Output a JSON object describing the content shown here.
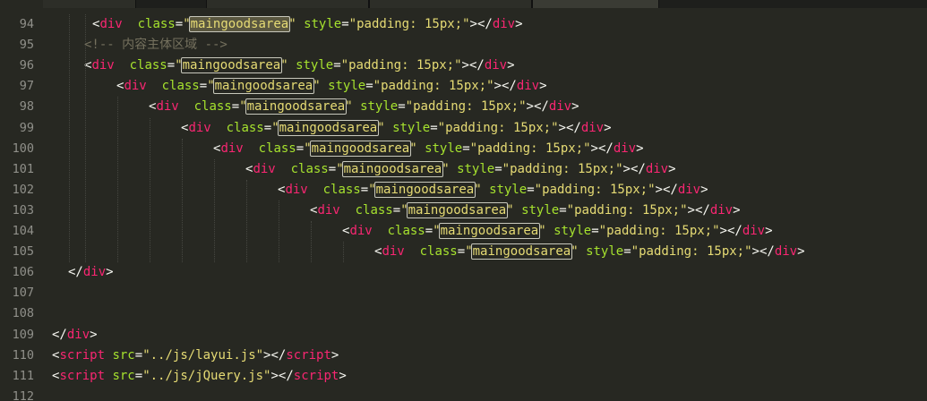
{
  "editor": {
    "tabs": [
      {
        "label": "",
        "active": false
      },
      {
        "label": "",
        "active": false
      },
      {
        "label": "",
        "active": false
      },
      {
        "label": "",
        "active": true
      }
    ]
  },
  "lines": [
    {
      "num": "94",
      "indent": 5,
      "kind": "div",
      "tag_open": "<",
      "tag": "div",
      "sp1": "  ",
      "attr": "class",
      "eq": "=",
      "q1": "\"",
      "cls": "maingoodsarea",
      "q2": "\"",
      "sp2": " ",
      "style_attr": "style",
      "eq2": "=",
      "style_val": "\"padding: 15px;\"",
      "close": "></",
      "close_tag": "div",
      "end": ">",
      "selected": true
    },
    {
      "num": "95",
      "indent": 4,
      "kind": "comment",
      "text": "<!-- 内容主体区域 -->"
    },
    {
      "num": "96",
      "indent": 4,
      "kind": "div",
      "tag_open": "<",
      "tag": "div",
      "sp1": "  ",
      "attr": "class",
      "eq": "=",
      "q1": "\"",
      "cls": "maingoodsarea",
      "q2": "\"",
      "sp2": " ",
      "style_attr": "style",
      "eq2": "=",
      "style_val": "\"padding: 15px;\"",
      "close": "></",
      "close_tag": "div",
      "end": ">"
    },
    {
      "num": "97",
      "indent": 8,
      "kind": "div",
      "tag_open": "<",
      "tag": "div",
      "sp1": "  ",
      "attr": "class",
      "eq": "=",
      "q1": "\"",
      "cls": "maingoodsarea",
      "q2": "\"",
      "sp2": " ",
      "style_attr": "style",
      "eq2": "=",
      "style_val": "\"padding: 15px;\"",
      "close": "></",
      "close_tag": "div",
      "end": ">"
    },
    {
      "num": "98",
      "indent": 12,
      "kind": "div",
      "tag_open": "<",
      "tag": "div",
      "sp1": "  ",
      "attr": "class",
      "eq": "=",
      "q1": "\"",
      "cls": "maingoodsarea",
      "q2": "\"",
      "sp2": " ",
      "style_attr": "style",
      "eq2": "=",
      "style_val": "\"padding: 15px;\"",
      "close": "></",
      "close_tag": "div",
      "end": ">"
    },
    {
      "num": "99",
      "indent": 16,
      "kind": "div",
      "tag_open": "<",
      "tag": "div",
      "sp1": "  ",
      "attr": "class",
      "eq": "=",
      "q1": "\"",
      "cls": "maingoodsarea",
      "q2": "\"",
      "sp2": " ",
      "style_attr": "style",
      "eq2": "=",
      "style_val": "\"padding: 15px;\"",
      "close": "></",
      "close_tag": "div",
      "end": ">"
    },
    {
      "num": "100",
      "indent": 20,
      "kind": "div",
      "tag_open": "<",
      "tag": "div",
      "sp1": "  ",
      "attr": "class",
      "eq": "=",
      "q1": "\"",
      "cls": "maingoodsarea",
      "q2": "\"",
      "sp2": " ",
      "style_attr": "style",
      "eq2": "=",
      "style_val": "\"padding: 15px;\"",
      "close": "></",
      "close_tag": "div",
      "end": ">"
    },
    {
      "num": "101",
      "indent": 24,
      "kind": "div",
      "tag_open": "<",
      "tag": "div",
      "sp1": "  ",
      "attr": "class",
      "eq": "=",
      "q1": "\"",
      "cls": "maingoodsarea",
      "q2": "\"",
      "sp2": " ",
      "style_attr": "style",
      "eq2": "=",
      "style_val": "\"padding: 15px;\"",
      "close": "></",
      "close_tag": "div",
      "end": ">"
    },
    {
      "num": "102",
      "indent": 28,
      "kind": "div",
      "tag_open": "<",
      "tag": "div",
      "sp1": "  ",
      "attr": "class",
      "eq": "=",
      "q1": "\"",
      "cls": "maingoodsarea",
      "q2": "\"",
      "sp2": " ",
      "style_attr": "style",
      "eq2": "=",
      "style_val": "\"padding: 15px;\"",
      "close": "></",
      "close_tag": "div",
      "end": ">"
    },
    {
      "num": "103",
      "indent": 32,
      "kind": "div",
      "tag_open": "<",
      "tag": "div",
      "sp1": "  ",
      "attr": "class",
      "eq": "=",
      "q1": "\"",
      "cls": "maingoodsarea",
      "q2": "\"",
      "sp2": " ",
      "style_attr": "style",
      "eq2": "=",
      "style_val": "\"padding: 15px;\"",
      "close": "></",
      "close_tag": "div",
      "end": ">"
    },
    {
      "num": "104",
      "indent": 36,
      "kind": "div",
      "tag_open": "<",
      "tag": "div",
      "sp1": "  ",
      "attr": "class",
      "eq": "=",
      "q1": "\"",
      "cls": "maingoodsarea",
      "q2": "\"",
      "sp2": " ",
      "style_attr": "style",
      "eq2": "=",
      "style_val": "\"padding: 15px;\"",
      "close": "></",
      "close_tag": "div",
      "end": ">"
    },
    {
      "num": "105",
      "indent": 40,
      "kind": "div",
      "tag_open": "<",
      "tag": "div",
      "sp1": "  ",
      "attr": "class",
      "eq": "=",
      "q1": "\"",
      "cls": "maingoodsarea",
      "q2": "\"",
      "sp2": " ",
      "style_attr": "style",
      "eq2": "=",
      "style_val": "\"padding: 15px;\"",
      "close": "></",
      "close_tag": "div",
      "end": ">"
    },
    {
      "num": "106",
      "indent": 2,
      "kind": "closetag",
      "open": "</",
      "tag": "div",
      "end": ">"
    },
    {
      "num": "107",
      "indent": 0,
      "kind": "empty"
    },
    {
      "num": "108",
      "indent": 0,
      "kind": "empty"
    },
    {
      "num": "109",
      "indent": 0,
      "kind": "closetag",
      "open": "</",
      "tag": "div",
      "end": ">"
    },
    {
      "num": "110",
      "indent": 0,
      "kind": "script",
      "tag_open": "<",
      "tag": "script",
      "sp": " ",
      "attr": "src",
      "eq": "=",
      "val": "\"../js/layui.js\"",
      "close": "></",
      "close_tag": "script",
      "end": ">"
    },
    {
      "num": "111",
      "indent": 0,
      "kind": "script",
      "tag_open": "<",
      "tag": "script",
      "sp": " ",
      "attr": "src",
      "eq": "=",
      "val": "\"../js/jQuery.js\"",
      "close": "></",
      "close_tag": "script",
      "end": ">"
    },
    {
      "num": "112",
      "indent": 0,
      "kind": "empty"
    }
  ],
  "colors": {
    "background": "#272822",
    "line_number": "#90908a",
    "tag": "#f92672",
    "attribute": "#a6e22e",
    "string": "#e6db74",
    "comment": "#75715e",
    "text": "#f8f8f2"
  }
}
